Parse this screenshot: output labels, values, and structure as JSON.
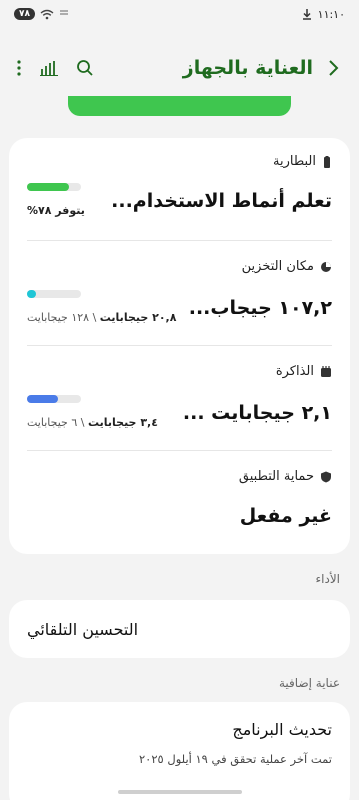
{
  "status_bar": {
    "time": "١١:١٠",
    "battery": "٧٨"
  },
  "header": {
    "title": "العناية بالجهاز"
  },
  "battery": {
    "label": "البطارية",
    "status": "تعلم أنماط الاستخدام...",
    "available": "يتوفر ٧٨%",
    "level": 0.78,
    "color": "#3fc64f"
  },
  "storage": {
    "label": "مكان التخزين",
    "value": "١٠٧,٢ جيجاب...",
    "used": "٢٠,٨ جيجابايت",
    "total": "\\ ١٢٨ جيجابايت",
    "level": 0.16,
    "color": "#1fc6d6"
  },
  "memory": {
    "label": "الذاكرة",
    "value": "٢,١ جيجابايت ...",
    "used": "٣,٤ جيجابايت",
    "total": "\\ ٦ جيجابايت",
    "level": 0.57,
    "color": "#4a7be8"
  },
  "app_protection": {
    "label": "حماية التطبيق",
    "value": "غير مفعل"
  },
  "performance_section": {
    "label": "الأداء",
    "auto_optimize": "التحسين التلقائي"
  },
  "additional_section": {
    "label": "عناية إضافية",
    "software_update": "تحديث البرنامج",
    "last_check": "تمت آخر عملية تحقق في ١٩ أيلول ٢٠٢٥"
  }
}
